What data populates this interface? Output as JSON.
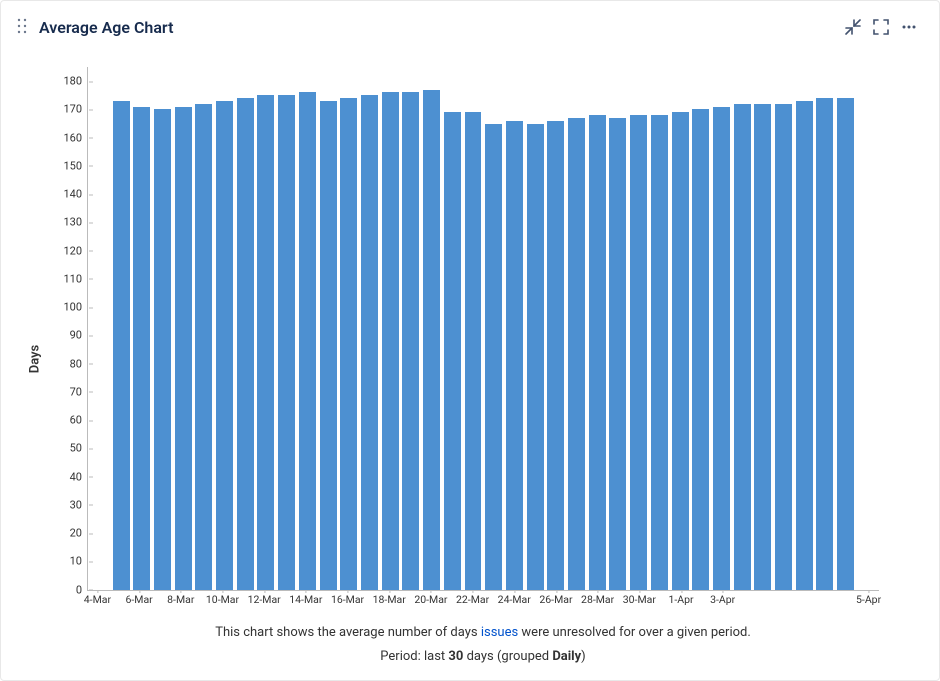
{
  "header": {
    "title": "Average Age Chart",
    "icons": {
      "drag": "drag-handle-icon",
      "collapse": "collapse-icon",
      "fullscreen": "fullscreen-icon",
      "more": "more-icon"
    }
  },
  "chart_data": {
    "type": "bar",
    "ylabel": "Days",
    "ylim": [
      0,
      185
    ],
    "yticks": [
      0,
      10,
      20,
      30,
      40,
      50,
      60,
      70,
      80,
      90,
      100,
      110,
      120,
      130,
      140,
      150,
      160,
      170,
      180
    ],
    "categories": [
      "4-Mar",
      "5-Mar",
      "6-Mar",
      "7-Mar",
      "8-Mar",
      "9-Mar",
      "10-Mar",
      "11-Mar",
      "12-Mar",
      "13-Mar",
      "14-Mar",
      "15-Mar",
      "16-Mar",
      "17-Mar",
      "18-Mar",
      "19-Mar",
      "20-Mar",
      "21-Mar",
      "22-Mar",
      "23-Mar",
      "24-Mar",
      "25-Mar",
      "26-Mar",
      "27-Mar",
      "28-Mar",
      "29-Mar",
      "30-Mar",
      "31-Mar",
      "1-Apr",
      "2-Apr",
      "3-Apr",
      "4-Apr",
      "5-Apr"
    ],
    "values": [
      173,
      171,
      170,
      171,
      172,
      173,
      174,
      175,
      175,
      176,
      173,
      174,
      175,
      176,
      176,
      177,
      169,
      169,
      165,
      166,
      165,
      166,
      167,
      168,
      167,
      168,
      168,
      169,
      170,
      171,
      172,
      172,
      172,
      173,
      174,
      174
    ],
    "xticks_labeled": [
      "4-Mar",
      "6-Mar",
      "8-Mar",
      "10-Mar",
      "12-Mar",
      "14-Mar",
      "16-Mar",
      "18-Mar",
      "20-Mar",
      "22-Mar",
      "24-Mar",
      "26-Mar",
      "28-Mar",
      "30-Mar",
      "1-Apr",
      "3-Apr",
      "5-Apr"
    ],
    "bar_color": "#4D90D1"
  },
  "caption": {
    "line1_pre": "This chart shows the average number of days ",
    "line1_link": "issues",
    "line1_post": " were unresolved for over a given period.",
    "line2_pre": "Period: last ",
    "line2_bold1": "30",
    "line2_mid": " days (grouped ",
    "line2_bold2": "Daily",
    "line2_post": ")"
  }
}
